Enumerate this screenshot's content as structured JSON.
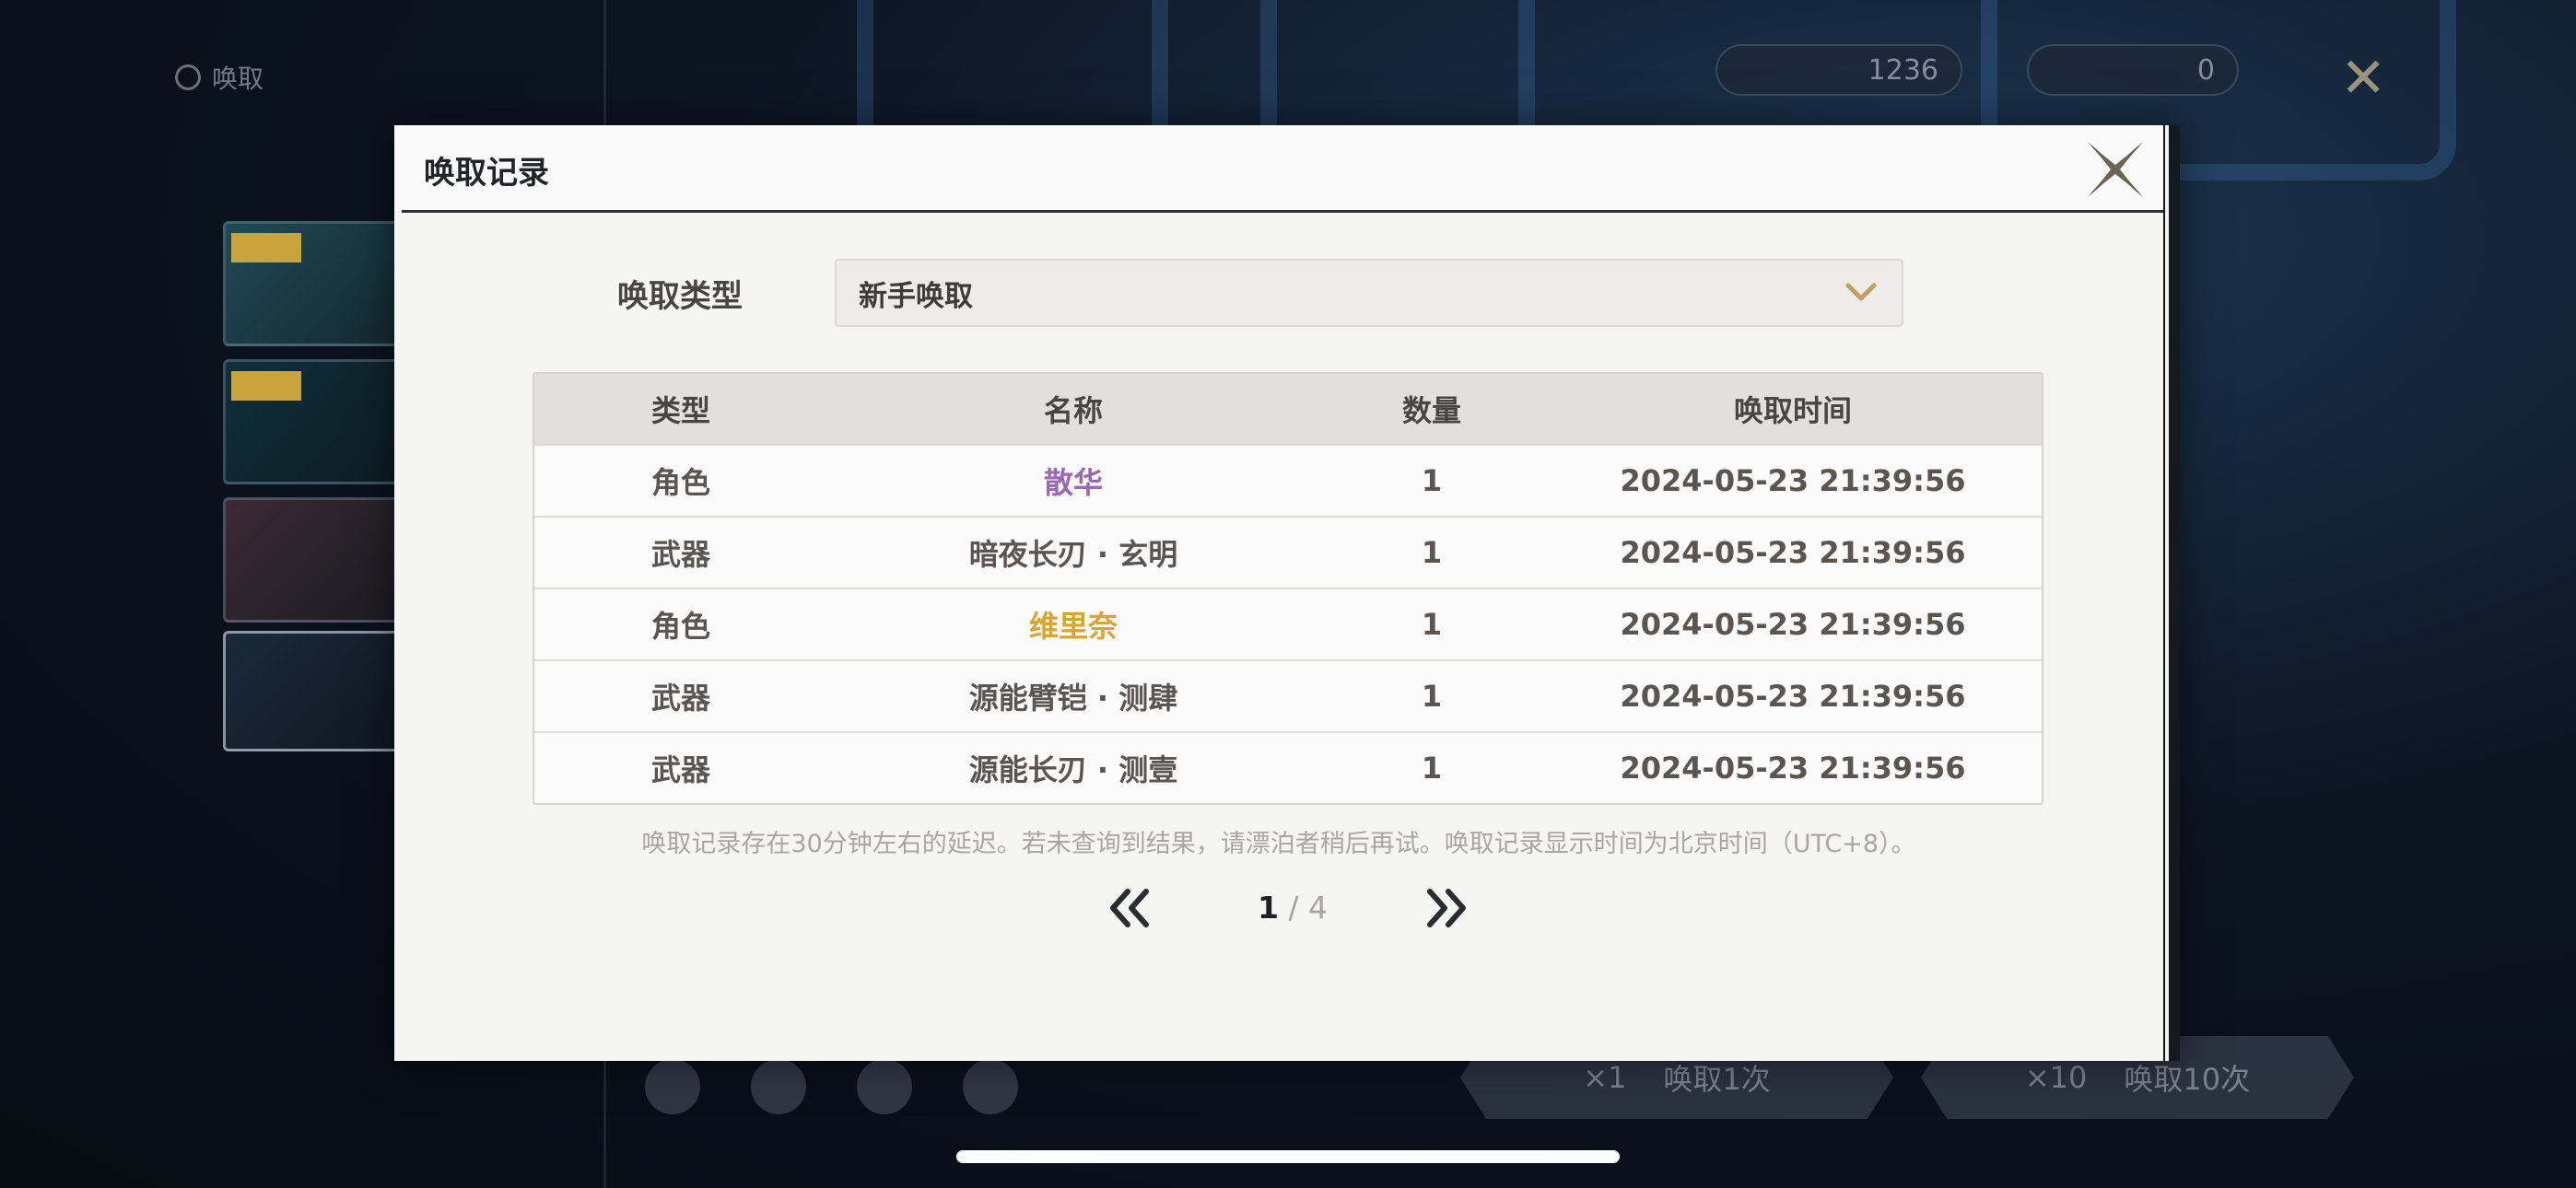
{
  "modal": {
    "title": "唤取记录",
    "filter_label": "唤取类型",
    "dropdown_value": "新手唤取",
    "table": {
      "headers": [
        "类型",
        "名称",
        "数量",
        "唤取时间"
      ],
      "rows": [
        {
          "type": "角色",
          "name": "散华",
          "qty": "1",
          "time": "2024-05-23 21:39:56",
          "rarity_color": "#9b69b3"
        },
        {
          "type": "武器",
          "name": "暗夜长刃 · 玄明",
          "qty": "1",
          "time": "2024-05-23 21:39:56",
          "rarity_color": "#5a5550"
        },
        {
          "type": "角色",
          "name": "维里奈",
          "qty": "1",
          "time": "2024-05-23 21:39:56",
          "rarity_color": "#d9a52c"
        },
        {
          "type": "武器",
          "name": "源能臂铠 · 测肆",
          "qty": "1",
          "time": "2024-05-23 21:39:56",
          "rarity_color": "#5a5550"
        },
        {
          "type": "武器",
          "name": "源能长刃 · 测壹",
          "qty": "1",
          "time": "2024-05-23 21:39:56",
          "rarity_color": "#5a5550"
        }
      ]
    },
    "note": "唤取记录存在30分钟左右的延迟。若未查询到结果，请漂泊者稍后再试。唤取记录显示时间为北京时间（UTC+8）。",
    "pager": {
      "current": "1",
      "separator": " / ",
      "total": "4"
    }
  },
  "background": {
    "wish_label": "唤取",
    "currency_1": "1236",
    "currency_2": "0",
    "pull_one": "唤取1次",
    "pull_ten": "唤取10次",
    "pull_one_cost": "×1",
    "pull_ten_cost": "×10"
  },
  "colors": {
    "accent_gold": "#c9a43a",
    "purple_rarity": "#9b69b3",
    "gold_rarity": "#d9a52c"
  }
}
